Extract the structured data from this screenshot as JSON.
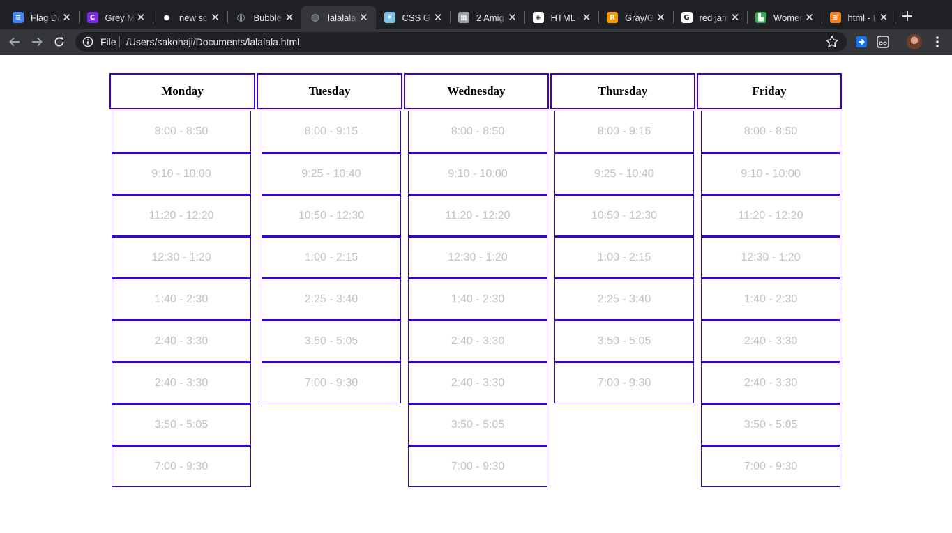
{
  "browser": {
    "tabs": [
      {
        "title": "Flag Da",
        "icon": "docs-icon",
        "color": "#4285f4",
        "glyph": "≡"
      },
      {
        "title": "Grey M",
        "icon": "canva-icon",
        "color": "#7d2ae8",
        "glyph": "C"
      },
      {
        "title": "new sc",
        "icon": "github-icon",
        "color": "#202124",
        "glyph": "●"
      },
      {
        "title": "Bubble",
        "icon": "globe-icon",
        "color": "#5f6368",
        "glyph": "◍"
      },
      {
        "title": "lalalala.",
        "icon": "globe-icon",
        "color": "#5f6368",
        "glyph": "◍"
      },
      {
        "title": "CSS Gr",
        "icon": "css-tricks-icon",
        "color": "#7fc4e6",
        "glyph": "✦"
      },
      {
        "title": "2 Amig",
        "icon": "site-icon",
        "color": "#9aa0a6",
        "glyph": "▦"
      },
      {
        "title": "HTML -",
        "icon": "codepen-icon",
        "color": "#ffffff",
        "glyph": "◈"
      },
      {
        "title": "Gray/G",
        "icon": "r-brand-icon",
        "color": "#f29900",
        "glyph": "R"
      },
      {
        "title": "red jam",
        "icon": "google-icon",
        "color": "#ffffff",
        "glyph": "G"
      },
      {
        "title": "Women",
        "icon": "bookmark-site-icon",
        "color": "#34a853",
        "glyph": "▙"
      },
      {
        "title": "html - I",
        "icon": "stackoverflow-icon",
        "color": "#f48024",
        "glyph": "≋"
      }
    ],
    "active_tab_index": 4,
    "scheme_label": "File",
    "url": "/Users/sakohaji/Documents/lalalala.html"
  },
  "schedule": {
    "days": [
      {
        "name": "Monday",
        "slots": [
          "8:00 - 8:50",
          "9:10 - 10:00",
          "11:20 - 12:20",
          "12:30 - 1:20",
          "1:40 - 2:30",
          "2:40 - 3:30",
          "2:40 - 3:30",
          "3:50 - 5:05",
          "7:00 - 9:30"
        ]
      },
      {
        "name": "Tuesday",
        "slots": [
          "8:00 - 9:15",
          "9:25 - 10:40",
          "10:50 - 12:30",
          "1:00 - 2:15",
          "2:25 - 3:40",
          "3:50 - 5:05",
          "7:00 - 9:30"
        ]
      },
      {
        "name": "Wednesday",
        "slots": [
          "8:00 - 8:50",
          "9:10 - 10:00",
          "11:20 - 12:20",
          "12:30 - 1:20",
          "1:40 - 2:30",
          "2:40 - 3:30",
          "2:40 - 3:30",
          "3:50 - 5:05",
          "7:00 - 9:30"
        ]
      },
      {
        "name": "Thursday",
        "slots": [
          "8:00 - 9:15",
          "9:25 - 10:40",
          "10:50 - 12:30",
          "1:00 - 2:15",
          "2:25 - 3:40",
          "3:50 - 5:05",
          "7:00 - 9:30"
        ]
      },
      {
        "name": "Friday",
        "slots": [
          "8:00 - 8:50",
          "9:10 - 10:00",
          "11:20 - 12:20",
          "12:30 - 1:20",
          "1:40 - 2:30",
          "2:40 - 3:30",
          "2:40 - 3:30",
          "3:50 - 5:05",
          "7:00 - 9:30"
        ]
      }
    ],
    "colors": {
      "border": "#3c00d6",
      "slot_text": "#c2c2c2",
      "header_text": "#000000"
    }
  }
}
